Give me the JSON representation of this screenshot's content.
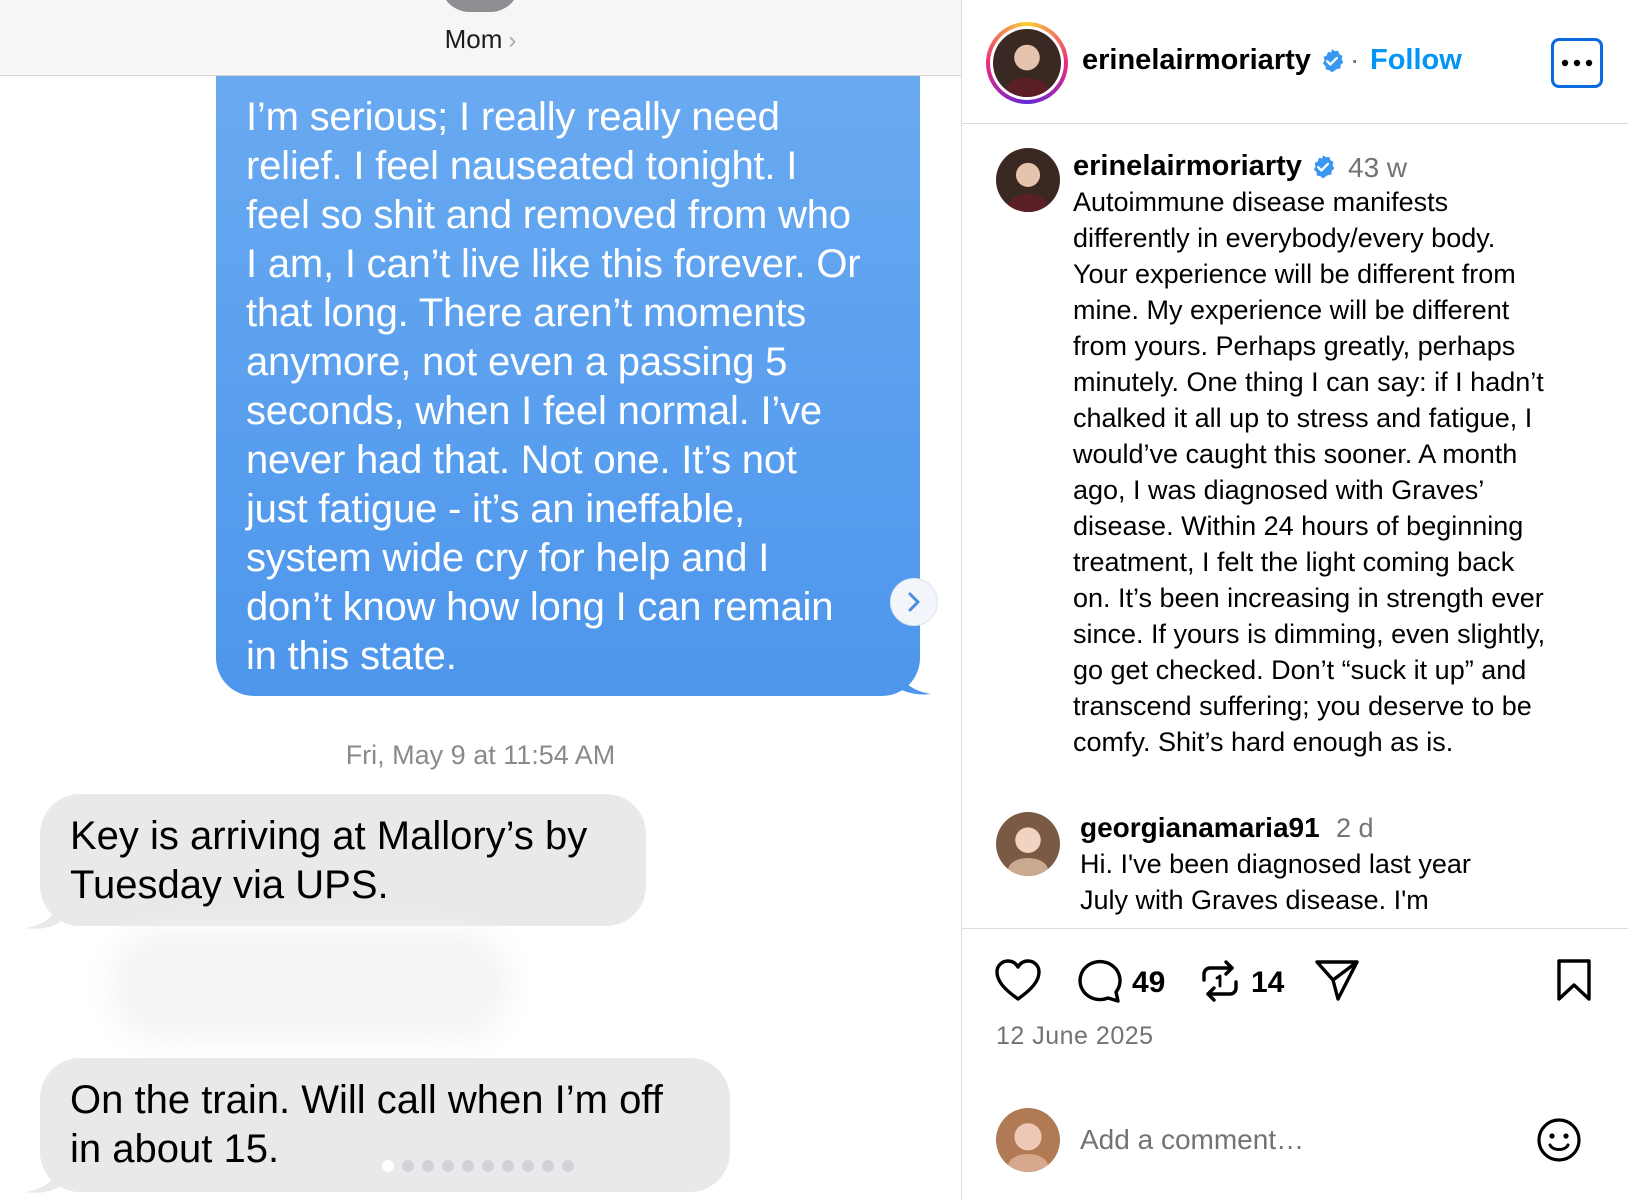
{
  "messages": {
    "contact_name": "Mom",
    "chevron": "›",
    "sent_text": "I’m serious; I really really need\nrelief. I feel nauseated tonight. I\nfeel so shit and removed from who\nI am, I can’t live like this forever. Or\nthat long. There aren’t moments\nanymore, not even a passing 5\nseconds, when I feel normal. I’ve\nnever had that. Not one. It’s not\njust fatigue - it’s an ineffable,\nsystem wide cry for help and I\ndon’t know how long I can remain\nin this state.",
    "timestamp": "Fri, May 9 at 11:54 AM",
    "received": [
      "Key is arriving at Mallory’s by\nTuesday via UPS.",
      "On the train. Will call when I’m off\nin about 15."
    ],
    "page_dots": 10,
    "active_dot": 0
  },
  "instagram": {
    "username": "erinelairmoriarty",
    "separator": "·",
    "follow_label": "Follow",
    "caption": {
      "username": "erinelairmoriarty",
      "time": "43 w",
      "text": "Autoimmune disease manifests\ndifferently in everybody/every body.\nYour experience will be different from\nmine. My experience will be different\nfrom yours. Perhaps greatly, perhaps\nminutely. One thing I can say: if I hadn’t\nchalked it all up to stress and fatigue, I\nwould’ve caught this sooner. A month\nago, I was diagnosed with Graves’\ndisease. Within 24 hours of beginning\ntreatment, I felt the light coming back\non. It’s been increasing in strength ever\nsince. If yours is dimming, even slightly,\ngo get checked. Don’t “suck it up” and\ntranscend suffering; you deserve to be\ncomfy. Shit’s hard enough as is."
    },
    "comment": {
      "username": "georgianamaria91",
      "time": "2 d",
      "text": "Hi. I've been diagnosed last year\nJuly with Graves disease. I'm"
    },
    "actions": {
      "comment_count": "49",
      "repost_count": "14"
    },
    "post_date": "12 June 2025",
    "comment_placeholder": "Add a comment…",
    "icons": [
      "heart-icon",
      "comment-icon",
      "repost-icon",
      "share-icon",
      "bookmark-icon",
      "emoji-icon",
      "more-icon",
      "verified-icon"
    ],
    "colors": {
      "link": "#0095f6",
      "verified": "#3897f0",
      "sent_bubble": "#5aa0ee",
      "received_bubble": "#e9e9eb"
    }
  }
}
